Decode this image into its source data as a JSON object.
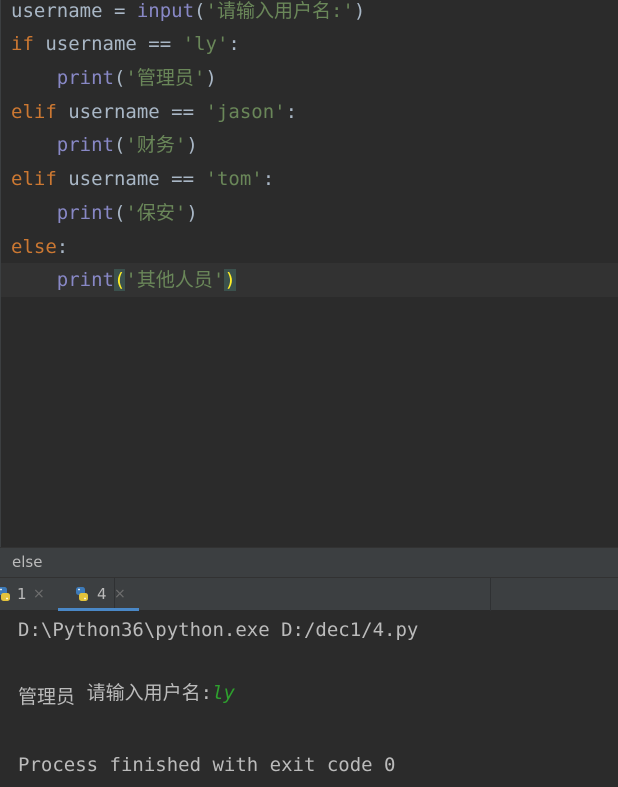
{
  "editor": {
    "lines": [
      [
        {
          "t": "username",
          "c": "var"
        },
        {
          "t": " = ",
          "c": "op"
        },
        {
          "t": "input",
          "c": "fn"
        },
        {
          "t": "(",
          "c": "paren"
        },
        {
          "t": "'请输入用户名:'",
          "c": "str"
        },
        {
          "t": ")",
          "c": "paren"
        }
      ],
      [
        {
          "t": "if",
          "c": "kw"
        },
        {
          "t": " username ",
          "c": "var"
        },
        {
          "t": "==",
          "c": "op"
        },
        {
          "t": " ",
          "c": "op"
        },
        {
          "t": "'ly'",
          "c": "str"
        },
        {
          "t": ":",
          "c": "op"
        }
      ],
      [
        {
          "t": "    ",
          "c": "op"
        },
        {
          "t": "print",
          "c": "fn"
        },
        {
          "t": "(",
          "c": "paren"
        },
        {
          "t": "'管理员'",
          "c": "str"
        },
        {
          "t": ")",
          "c": "paren"
        }
      ],
      [
        {
          "t": "elif",
          "c": "kw"
        },
        {
          "t": " username ",
          "c": "var"
        },
        {
          "t": "==",
          "c": "op"
        },
        {
          "t": " ",
          "c": "op"
        },
        {
          "t": "'jason'",
          "c": "str"
        },
        {
          "t": ":",
          "c": "op"
        }
      ],
      [
        {
          "t": "    ",
          "c": "op"
        },
        {
          "t": "print",
          "c": "fn"
        },
        {
          "t": "(",
          "c": "paren"
        },
        {
          "t": "'财务'",
          "c": "str"
        },
        {
          "t": ")",
          "c": "paren"
        }
      ],
      [
        {
          "t": "elif",
          "c": "kw"
        },
        {
          "t": " username ",
          "c": "var"
        },
        {
          "t": "==",
          "c": "op"
        },
        {
          "t": " ",
          "c": "op"
        },
        {
          "t": "'tom'",
          "c": "str"
        },
        {
          "t": ":",
          "c": "op"
        }
      ],
      [
        {
          "t": "    ",
          "c": "op"
        },
        {
          "t": "print",
          "c": "fn"
        },
        {
          "t": "(",
          "c": "paren"
        },
        {
          "t": "'保安'",
          "c": "str"
        },
        {
          "t": ")",
          "c": "paren"
        }
      ],
      [
        {
          "t": "else",
          "c": "kw"
        },
        {
          "t": ":",
          "c": "op"
        }
      ],
      [
        {
          "t": "    ",
          "c": "op"
        },
        {
          "t": "print",
          "c": "fn"
        },
        {
          "t": "(",
          "c": "paren match"
        },
        {
          "t": "'其他人员'",
          "c": "str"
        },
        {
          "t": ")",
          "c": "paren match"
        }
      ]
    ],
    "current_line": 8
  },
  "breadcrumb": {
    "text": "else"
  },
  "run_tabs": {
    "tab1": {
      "label": "1",
      "close": "×"
    },
    "tab2": {
      "label": "4",
      "close": "×"
    }
  },
  "console": {
    "command": "D:\\Python36\\python.exe D:/dec1/4.py",
    "prompt": "请输入用户名:",
    "input_value": "ly",
    "output": "管理员",
    "exit_message": "Process finished with exit code 0"
  },
  "colors": {
    "editor_bg": "#2b2b2b",
    "keyword": "#cc7832",
    "string": "#6a8759",
    "builtin": "#8888c6",
    "text": "#a9b7c6",
    "active_tab_underline": "#4a88c7",
    "user_input": "#2ea02e"
  }
}
